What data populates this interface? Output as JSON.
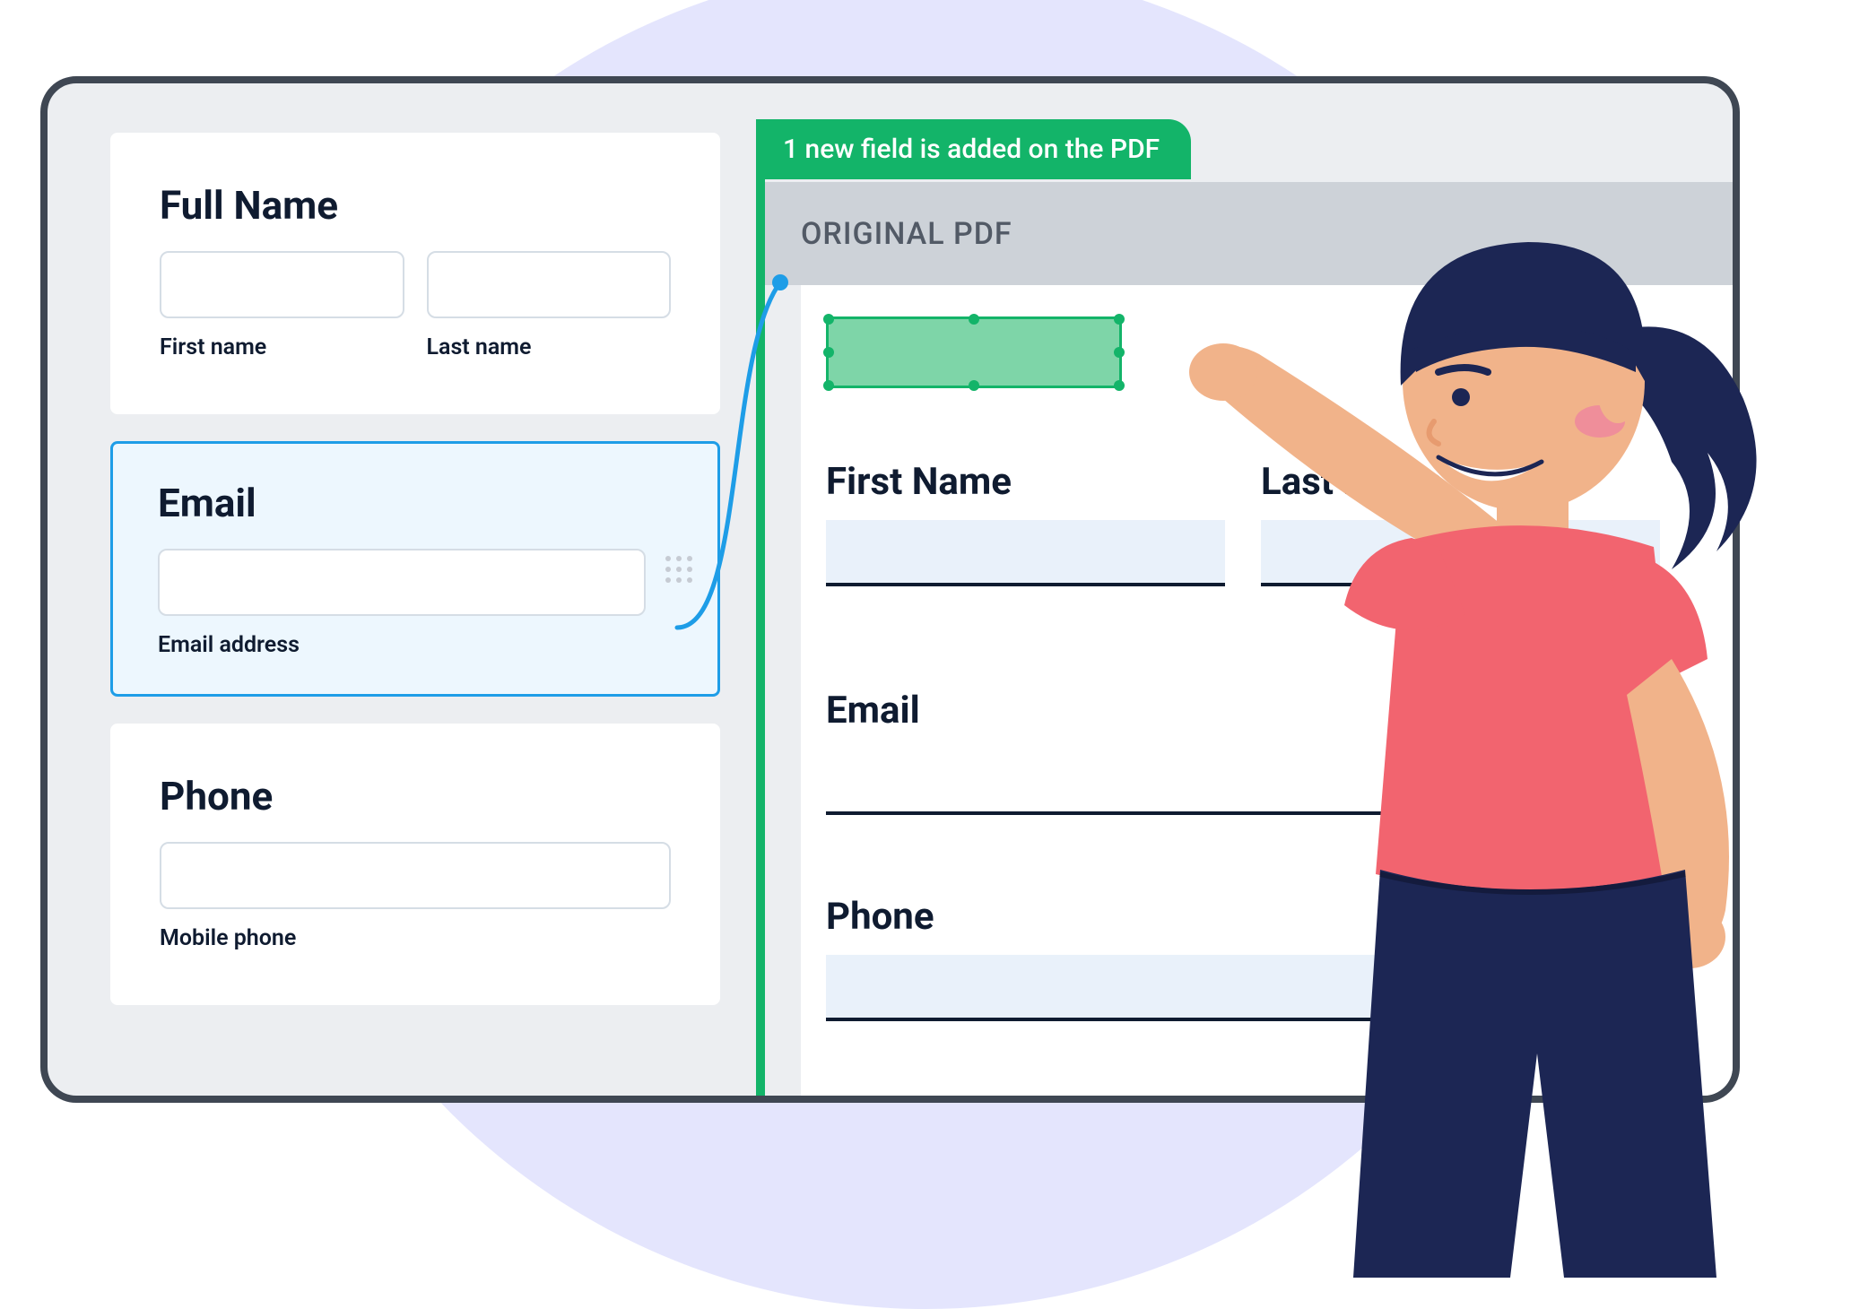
{
  "form": {
    "fullName": {
      "title": "Full Name",
      "firstLabel": "First name",
      "lastLabel": "Last name"
    },
    "email": {
      "title": "Email",
      "label": "Email address"
    },
    "phone": {
      "title": "Phone",
      "label": "Mobile phone"
    }
  },
  "notification": "1 new field is added on the PDF",
  "pdf": {
    "header": "ORIGINAL PDF",
    "firstName": "First Name",
    "lastName": "Last Name",
    "email": "Email",
    "phone": "Phone"
  }
}
